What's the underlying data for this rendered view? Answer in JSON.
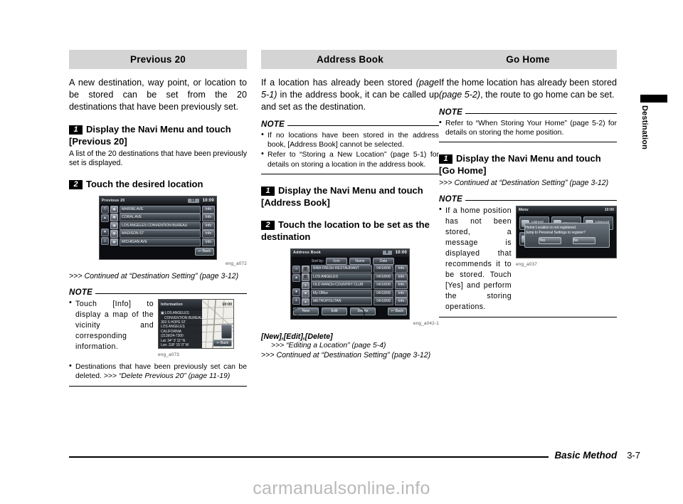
{
  "footer": {
    "title": "Basic Method",
    "page": "3-7"
  },
  "watermark": "carmanualsonline.info",
  "side_tab": {
    "label": "Destination"
  },
  "columns": [
    {
      "title": "Previous 20",
      "intro": "A new destination, way point, or location to be stored can be set from the 20 destinations that have been previously set.",
      "step1": {
        "num": "1",
        "heading": "Display the Navi Menu and touch [Previous 20]",
        "sub": "A list of the 20 destinations that have been previously set is displayed."
      },
      "step2": {
        "num": "2",
        "heading": "Touch the desired location"
      },
      "screen": {
        "title": "Previous 20",
        "badge": "13",
        "clock": "10:00",
        "scroll_top": [
          "⤒",
          "▲"
        ],
        "scroll_bottom": [
          "▼",
          "⤓"
        ],
        "rows": [
          {
            "icon": "▣",
            "name": "MARINE AVE",
            "info": "Info"
          },
          {
            "icon": "▣",
            "name": "CORAL AVE",
            "info": "Info"
          },
          {
            "icon": "▣",
            "name": "LOS ANGELES CONVENTION BUREAU",
            "info": "Info"
          },
          {
            "icon": "▣",
            "name": "MADISON ST",
            "info": "Info"
          },
          {
            "icon": "▣",
            "name": "MICHIGAN AVE",
            "info": "Info"
          }
        ],
        "back": "↩ Back",
        "caption": "eng_a072"
      },
      "continued": ">>> Continued at “Destination Setting” (page 3-12)",
      "note_label": "NOTE",
      "note_item_1": "Touch [Info] to display a map of the vicinity and corresponding information.",
      "note_item_2_a": "Destinations that have been previously set can be deleted. >>> ",
      "note_item_2_b": "“Delete Previous 20” (page 11-19)",
      "map": {
        "panel_title": "Information",
        "clock": "10:00",
        "lines": [
          "▣ LOS ANGELES",
          "CONVENTION BUREAU",
          "303 S HOPE ST",
          "LOS ANGELES",
          "CALIFORNIA",
          "(213)624-7300",
          "Lat:   34°  3′ 11″ N",
          "Lon: 118° 15′  0″ W"
        ],
        "back": "↩ Back",
        "caption": "eng_a073"
      }
    },
    {
      "title": "Address Book",
      "intro_a": "If a location has already been stored ",
      "intro_ital": "(page 5-1)",
      "intro_b": " in the address book, it can be called up and set as the destination.",
      "note_label": "NOTE",
      "note_items": [
        "If no locations have been stored in the address book, [Address Book] cannot be selected.",
        "Refer to “Storing a New Location” (page 5-1) for details on storing a location in the address book."
      ],
      "step1": {
        "num": "1",
        "heading": "Display the Navi Menu and touch [Address Book]"
      },
      "step2": {
        "num": "2",
        "heading": "Touch the location to be set as the destination"
      },
      "screen": {
        "title": "Address Book",
        "badge": "8",
        "clock": "10:00",
        "sort_label": "Sort by:",
        "sort_buttons": [
          "Icon",
          "Name",
          "Date"
        ],
        "rows": [
          {
            "icon": "⬛",
            "name": "BIBA FRESH RESTAURANT",
            "date": "04/18/08",
            "info": "Info"
          },
          {
            "icon": "⬛",
            "name": "LOS ANGELES",
            "date": "04/18/08",
            "info": "Info"
          },
          {
            "icon": "●",
            "name": "OLD RANCH COUNTRY CLUB",
            "date": "04/18/08",
            "info": "Info"
          },
          {
            "icon": "■",
            "name": "My Office",
            "date": "04/18/08",
            "info": "Info"
          },
          {
            "icon": "▲",
            "name": "METROPOLITAN",
            "date": "04/18/08",
            "info": "Info"
          }
        ],
        "footer_buttons": [
          "New",
          "Edit",
          "Delete"
        ],
        "back": "↩ Back",
        "caption": "eng_a042-1"
      },
      "callout": "[New],[Edit],[Delete]",
      "callout_sub": ">>> “Editing a Location” (page 5-4)",
      "continued": ">>> Continued at “Destination Setting” (page 3-12)"
    },
    {
      "title": "Go Home",
      "intro_a": "If the home location has already been stored ",
      "intro_ital": "(page 5-2)",
      "intro_b": ", the route to go home can be set.",
      "note_label": "NOTE",
      "note_item": "Refer to “When Storing Your Home” (page 5-2) for details on storing the home position.",
      "step1": {
        "num": "1",
        "heading": "Display the Navi Menu and touch [Go Home]"
      },
      "continued": ">>> Continued at “Destination Setting” (page 3-12)",
      "note2_label": "NOTE",
      "note2_item": "If a home position has not been stored, a message is displayed that recommends it to be stored. Touch [Yes] and perform the storing operations.",
      "menu": {
        "title": "Menu",
        "clock": "10:00",
        "tiles": [
          "Address/ Intersection",
          "POI Name",
          "Advanced Search",
          "Navigation Settings",
          "Navigation Tools"
        ],
        "dialog_line1": "Home Location is not registered.",
        "dialog_line2": "Jump to Personal Settings to register?",
        "dialog_yes": "Yes",
        "dialog_no": "No",
        "caption": "eng_a037"
      }
    }
  ]
}
